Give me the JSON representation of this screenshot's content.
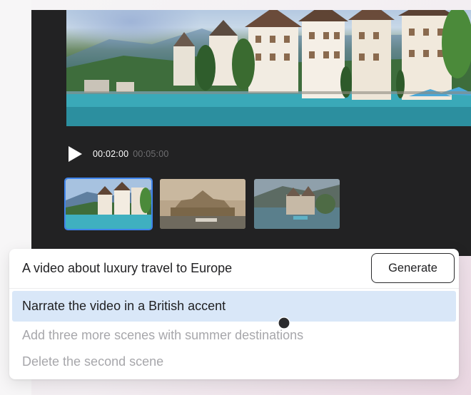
{
  "player": {
    "current_time": "00:02:00",
    "total_time": "00:05:00",
    "progress": 0.4,
    "play_icon": "play-icon",
    "scenes": [
      {
        "label": "lake-village-scene",
        "active": true
      },
      {
        "label": "city-river-scene",
        "active": false
      },
      {
        "label": "lakeside-castle-scene",
        "active": false
      }
    ]
  },
  "prompt": {
    "text": "A video about luxury travel to Europe",
    "generate_label": "Generate"
  },
  "suggestions": [
    {
      "text": "Narrate the video in a British accent",
      "highlighted": true
    },
    {
      "text": "Add three more scenes with summer destinations",
      "highlighted": false
    },
    {
      "text": "Delete the second scene",
      "highlighted": false
    }
  ],
  "colors": {
    "accent": "#3f84ec",
    "highlight": "#d9e7f8",
    "player_bg": "#222223"
  }
}
